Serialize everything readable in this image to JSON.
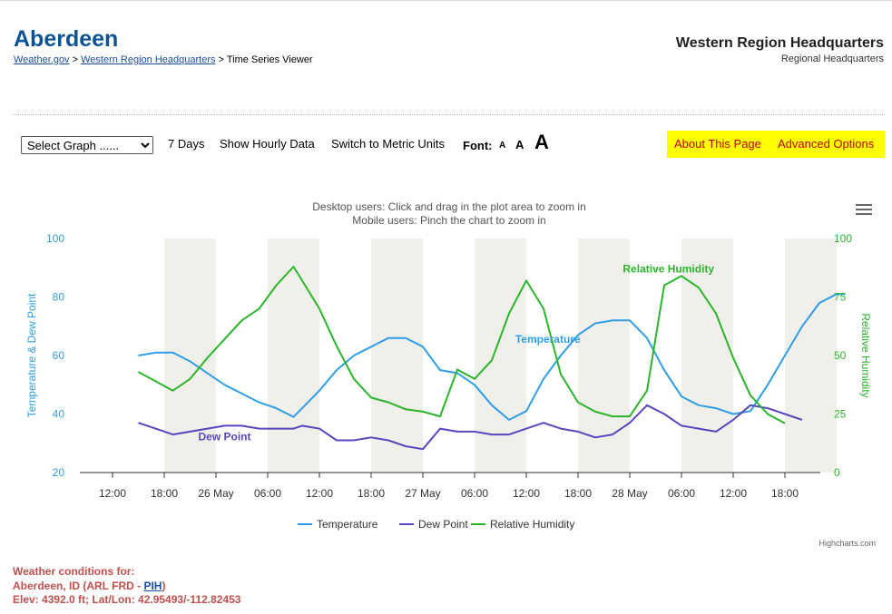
{
  "header": {
    "title": "Aberdeen",
    "breadcrumb": {
      "home": "Weather.gov",
      "sep1": " > ",
      "region": "Western Region Headquarters",
      "sep2": " > ",
      "current": "Time Series Viewer"
    },
    "office_name": "Western Region Headquarters",
    "office_sub": "Regional Headquarters"
  },
  "toolbar": {
    "select_graph": {
      "selected": "Select Graph ......"
    },
    "days": "7 Days",
    "hourly": "Show Hourly Data",
    "units": "Switch to Metric Units",
    "font_label": "Font:",
    "font_small": "A",
    "font_medium": "A",
    "font_large": "A",
    "about": "About This Page",
    "advanced": "Advanced Options",
    "highlight_color": "#ffff00",
    "link_color": "#c00000"
  },
  "chart_data": {
    "type": "line",
    "subtitle_line1": "Desktop users: Click and drag in the plot area to zoom in",
    "subtitle_line2": "Mobile users: Pinch the chart to zoom in",
    "y_left_label": "Temperature & Dew Point",
    "y_right_label": "Relative Humidity",
    "y_left_ticks": [
      "100",
      "80",
      "60",
      "40",
      "20"
    ],
    "y_right_ticks": [
      "100",
      "75",
      "50",
      "25",
      "0"
    ],
    "ylim_left": [
      20,
      100
    ],
    "ylim_right": [
      0,
      100
    ],
    "x_ticks": [
      "12:00",
      "18:00",
      "26 May",
      "06:00",
      "12:00",
      "18:00",
      "27 May",
      "06:00",
      "12:00",
      "18:00",
      "28 May",
      "06:00",
      "12:00",
      "18:00"
    ],
    "x_start": "25 May 12:00",
    "x_step_hours": 6,
    "night_bands_hours": [
      [
        6,
        12
      ],
      [
        18,
        24
      ],
      [
        30,
        36
      ],
      [
        42,
        48
      ],
      [
        54,
        60
      ],
      [
        66,
        72
      ],
      [
        78,
        84
      ]
    ],
    "hours": [
      3,
      5,
      7,
      9,
      11,
      13,
      15,
      17,
      19,
      21,
      22,
      24,
      26,
      28,
      30,
      32,
      34,
      36,
      38,
      40,
      42,
      44,
      46,
      48,
      50,
      52,
      54,
      56,
      58,
      60,
      62,
      64,
      66,
      68,
      70,
      72,
      74,
      76,
      78,
      80,
      82,
      84,
      85,
      86,
      87,
      89,
      91,
      93,
      95,
      97,
      98.5
    ],
    "series": [
      {
        "name": "Temperature",
        "color": "#2f9ee8",
        "axis": "left",
        "values": [
          60,
          61,
          61,
          58,
          54,
          50,
          47,
          44,
          42,
          39,
          42,
          48,
          55,
          60,
          63,
          66,
          66,
          63,
          55,
          54,
          50,
          43,
          38,
          41,
          52,
          60,
          67,
          71,
          72,
          72,
          66,
          55,
          46,
          43,
          42,
          40,
          41,
          50,
          60,
          70,
          78,
          81,
          81,
          null,
          null,
          null,
          null,
          null,
          null,
          null,
          null
        ],
        "note_label": "Temperature"
      },
      {
        "name": "Dew Point",
        "color": "#5a45c0",
        "axis": "left",
        "values": [
          37,
          35,
          33,
          34,
          35,
          36,
          36,
          35,
          35,
          35,
          36,
          35,
          31,
          31,
          32,
          31,
          29,
          28,
          35,
          34,
          34,
          33,
          33,
          35,
          37,
          35,
          34,
          32,
          33,
          37,
          43,
          40,
          36,
          35,
          34,
          38,
          43,
          42,
          40,
          38,
          null,
          null,
          null,
          null,
          null,
          null,
          null,
          null,
          null,
          null,
          null
        ],
        "note_label": "Dew Point"
      },
      {
        "name": "Relative Humidity",
        "color": "#2bb52b",
        "axis": "right",
        "values": [
          43,
          39,
          35,
          40,
          49,
          57,
          65,
          70,
          80,
          88,
          82,
          70,
          54,
          40,
          32,
          30,
          27,
          26,
          24,
          44,
          40,
          48,
          68,
          82,
          70,
          42,
          30,
          26,
          24,
          24,
          35,
          80,
          84,
          79,
          68,
          49,
          33,
          25,
          21,
          null,
          null,
          null,
          null,
          null,
          null,
          null,
          null,
          null,
          null,
          null,
          null
        ],
        "note_label": "Relative Humidity"
      }
    ],
    "legend": [
      "Temperature",
      "Dew Point",
      "Relative Humidity"
    ],
    "legend_placement": "bottom-center",
    "credits": "Highcharts.com",
    "grid": true
  },
  "conditions": {
    "heading": "Weather conditions for:",
    "station_prefix": "Aberdeen, ID (ARL FRD - ",
    "station_link": "PIH",
    "station_suffix": ")",
    "elev": "Elev: 4392.0 ft; Lat/Lon: 42.95493/-112.82453"
  }
}
